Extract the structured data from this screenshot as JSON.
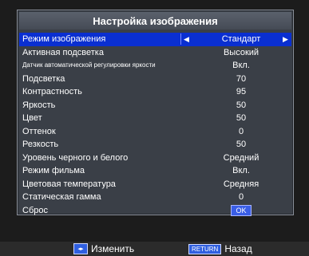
{
  "title": "Настройка изображения",
  "menu": {
    "items": [
      {
        "label": "Режим изображения",
        "value": "Стандарт",
        "selected": true
      },
      {
        "label": "Активная подсветка",
        "value": "Высокий"
      },
      {
        "label": "Датчик автоматической регулировки яркости",
        "value": "Вкл.",
        "small": true
      },
      {
        "label": "Подсветка",
        "value": "70"
      },
      {
        "label": "Контрастность",
        "value": "95"
      },
      {
        "label": "Яркость",
        "value": "50"
      },
      {
        "label": "Цвет",
        "value": "50"
      },
      {
        "label": "Оттенок",
        "value": "0"
      },
      {
        "label": "Резкость",
        "value": "50"
      },
      {
        "label": "Уровень черного и белого",
        "value": "Средний"
      },
      {
        "label": "Режим фильма",
        "value": "Вкл."
      },
      {
        "label": "Цветовая температура",
        "value": "Средняя"
      },
      {
        "label": "Статическая гамма",
        "value": "0"
      },
      {
        "label": "Сброс",
        "value": "OK",
        "badge": true
      }
    ]
  },
  "footer": {
    "change_label": "Изменить",
    "return_key": "RETURN",
    "back_label": "Назад"
  },
  "icons": {
    "left_arrow": "triangle-left-icon",
    "right_arrow": "triangle-right-icon",
    "nav_keys": "left-right-arrows-icon"
  },
  "colors": {
    "selected_row": "#0a2fd1",
    "panel": "#3a3f47",
    "title_bar": "#4f5560",
    "badge": "#3a5ee6"
  }
}
